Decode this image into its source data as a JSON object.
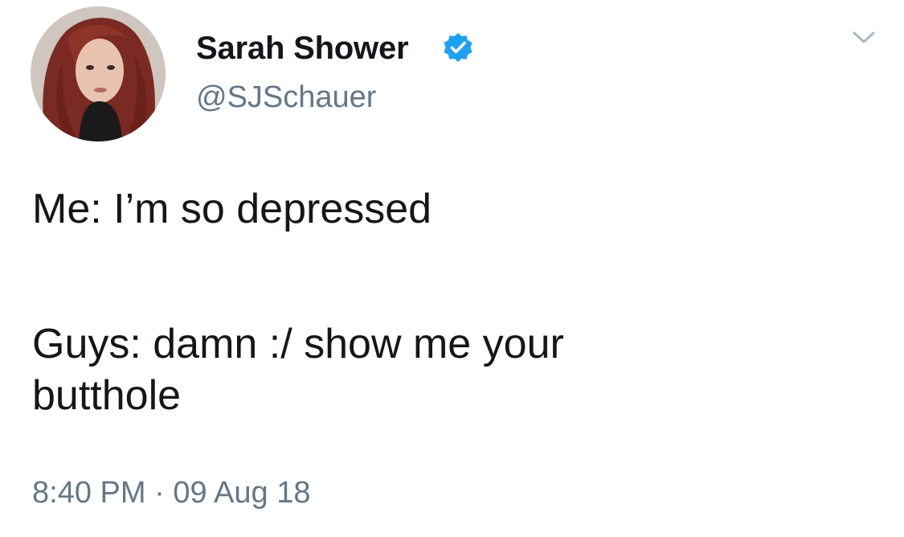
{
  "author": {
    "display_name": "Sarah Shower",
    "handle": "@SJSchauer",
    "verified": true,
    "avatar_icon": "profile-photo"
  },
  "tweet": {
    "lines": [
      "Me: I’m so depressed",
      "Guys: damn :/ show me your",
      "butthole"
    ],
    "time": "8:40 PM",
    "separator": "·",
    "date": "09 Aug 18"
  },
  "icons": {
    "verified_badge": "verified-check-icon",
    "menu": "chevron-down-icon"
  },
  "colors": {
    "name_text": "#14171a",
    "secondary_text": "#657786",
    "verified_blue": "#1da1f2",
    "background": "#ffffff"
  }
}
